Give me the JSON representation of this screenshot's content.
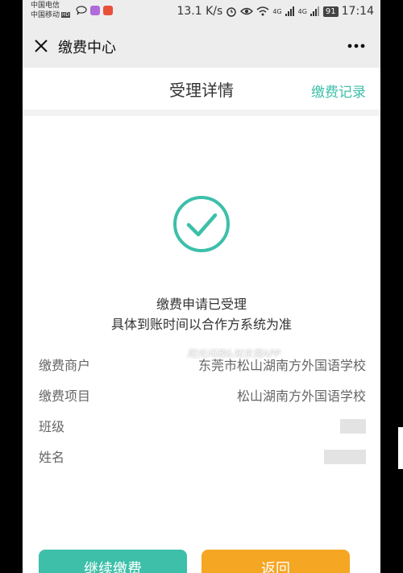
{
  "status_bar": {
    "carrier_1": "中国电信",
    "carrier_2": "中国移动",
    "hd_badge": "HD",
    "network_speed": "13.1 K/s",
    "signal_1": "4G",
    "signal_2": "4G",
    "battery": "91",
    "time": "17:14"
  },
  "wechat_header": {
    "title": "缴费中心",
    "close_icon": "close-icon",
    "more_icon": "more-icon"
  },
  "page": {
    "title": "受理详情",
    "history_link": "缴费记录"
  },
  "result": {
    "icon": "check-circle-icon",
    "icon_color": "#3dbfa9",
    "message_1": "缴费申请已受理",
    "message_2": "具体到账时间以合作方系统为准"
  },
  "details": [
    {
      "label": "缴费商户",
      "value": "东莞市松山湖南方外国语学校"
    },
    {
      "label": "缴费项目",
      "value": "松山湖南方外国语学校"
    },
    {
      "label": "班级",
      "value": ""
    },
    {
      "label": "姓名",
      "value": ""
    }
  ],
  "watermark": "阳光问政&知东莞APP",
  "buttons": {
    "continue": "继续缴费",
    "back": "返回"
  },
  "colors": {
    "accent": "#3dbfa9",
    "back_button": "#f5a623"
  }
}
